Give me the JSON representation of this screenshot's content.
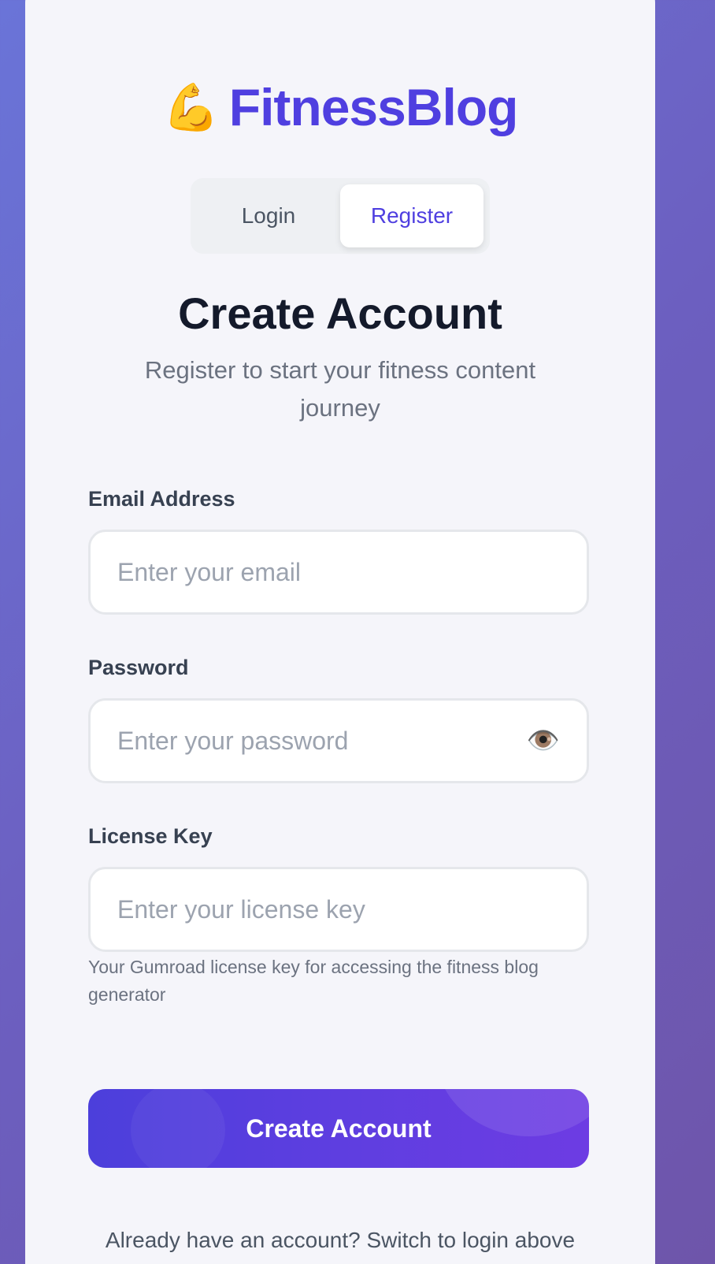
{
  "brand": {
    "icon": "💪",
    "name": "FitnessBlog"
  },
  "tabs": [
    {
      "label": "Login",
      "active": false
    },
    {
      "label": "Register",
      "active": true
    }
  ],
  "header": {
    "title": "Create Account",
    "subtitle": "Register to start your fitness content journey"
  },
  "form": {
    "email": {
      "label": "Email Address",
      "placeholder": "Enter your email",
      "value": ""
    },
    "password": {
      "label": "Password",
      "placeholder": "Enter your password",
      "value": "",
      "toggle_icon": "👁️"
    },
    "license": {
      "label": "License Key",
      "placeholder": "Enter your license key",
      "value": "",
      "hint": "Your Gumroad license key for accessing the fitness blog generator"
    },
    "submit_label": "Create Account"
  },
  "footer": {
    "note": "Already have an account? Switch to login above"
  },
  "colors": {
    "accent": "#4f3fe0",
    "background_gradient_start": "#6a74d8",
    "background_gradient_end": "#6e55aa",
    "card": "#f5f5fa",
    "button_gradient_start": "#4c3fdb",
    "button_gradient_end": "#6d3ce3"
  }
}
